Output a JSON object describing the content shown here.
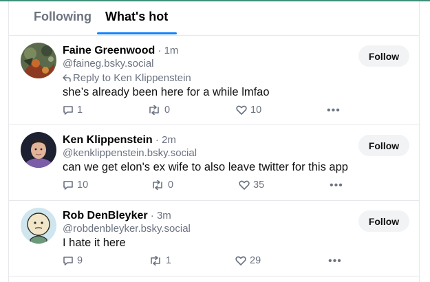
{
  "tabs": [
    {
      "label": "Following",
      "active": false
    },
    {
      "label": "What's hot",
      "active": true
    }
  ],
  "accent_color": "#1083fe",
  "posts": [
    {
      "author": "Faine Greenwood",
      "time": "1m",
      "handle": "@faineg.bsky.social",
      "reply_to": "Reply to Ken Klippenstein",
      "text": "she’s already been here for a while lmfao",
      "replies": "1",
      "reposts": "0",
      "likes": "10",
      "follow_label": "Follow",
      "more": "•••"
    },
    {
      "author": "Ken Klippenstein",
      "time": "2m",
      "handle": "@kenklippenstein.bsky.social",
      "text": "can we get elon's ex wife to also leave twitter for this app",
      "replies": "10",
      "reposts": "0",
      "likes": "35",
      "follow_label": "Follow",
      "more": "•••"
    },
    {
      "author": "Rob DenBleyker",
      "time": "3m",
      "handle": "@robdenbleyker.bsky.social",
      "text": "I hate it here",
      "replies": "9",
      "reposts": "1",
      "likes": "29",
      "follow_label": "Follow",
      "more": "•••"
    }
  ],
  "separator": " · "
}
